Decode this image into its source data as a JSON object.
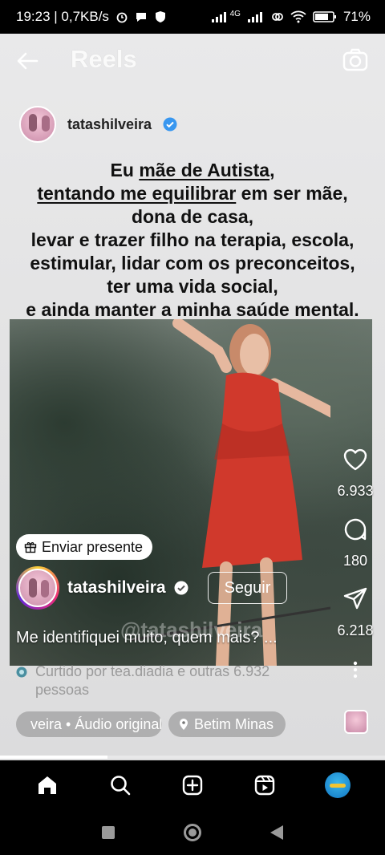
{
  "status_bar": {
    "time_speed": "19:23 | 0,7KB/s",
    "network": "4G",
    "battery": "71%"
  },
  "topbar": {
    "title": "Reels"
  },
  "post": {
    "username": "tatashilveira",
    "caption_lines": {
      "l1_pre": "Eu ",
      "l1_underline": "mãe de Autista",
      "l1_post": ",",
      "l2_underline": "tentando me equilibrar",
      "l2_post": " em ser mãe,",
      "l3": "dona de casa,",
      "l4": "levar e trazer filho na terapia, escola,",
      "l5": "estimular, lidar com os preconceitos,",
      "l6": "ter uma vida social,",
      "l7": "e ainda manter a minha saúde mental."
    },
    "watermark": "@tatashilveira"
  },
  "reel": {
    "gift_label": "Enviar presente",
    "author": "tatashilveira",
    "follow_label": "Seguir",
    "caption": "Me identifiquei muito, quem mais? ...",
    "liked_by": "Curtido por tea.diadia e outras 6.932 pessoas",
    "audio_tag": "veira • Áudio original",
    "location_tag": "Betim Minas",
    "progress": 0.28
  },
  "actions": {
    "likes": "6.933",
    "comments": "180",
    "shares": "6.218"
  },
  "colors": {
    "verified": "#3897f0",
    "background": "#e4e4e5",
    "nav_bg": "#000000"
  }
}
